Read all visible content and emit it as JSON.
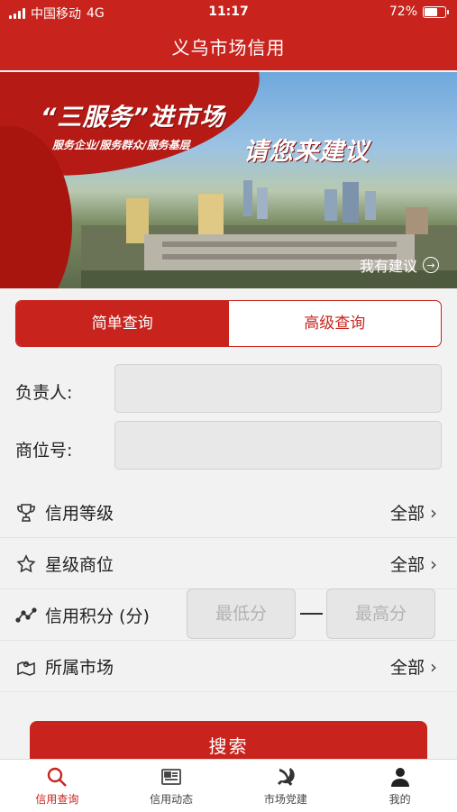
{
  "status_bar": {
    "carrier": "中国移动",
    "network": "4G",
    "time": "11:17",
    "battery": "72%",
    "battery_level": 0.72
  },
  "nav": {
    "title": "义乌市场信用"
  },
  "banner": {
    "headline": "“三服务”进市场",
    "subline": "服务企业/服务群众/服务基层",
    "slogan": "请您来建议",
    "suggest_link": "我有建议"
  },
  "tabs": {
    "simple": "简单查询",
    "advanced": "高级查询"
  },
  "form": {
    "owner_label": "负责人:",
    "booth_label": "商位号:",
    "credit_level": {
      "label": "信用等级",
      "value": "全部"
    },
    "star_booth": {
      "label": "星级商位",
      "value": "全部"
    },
    "credit_score": {
      "label": "信用积分 (分)",
      "min_placeholder": "最低分",
      "max_placeholder": "最高分"
    },
    "market": {
      "label": "所属市场",
      "value": "全部"
    }
  },
  "search_button": "搜索",
  "tabbar": [
    {
      "label": "信用查询",
      "icon": "search-icon"
    },
    {
      "label": "信用动态",
      "icon": "newspaper-icon"
    },
    {
      "label": "市场党建",
      "icon": "party-emblem-icon"
    },
    {
      "label": "我的",
      "icon": "person-icon"
    }
  ],
  "colors": {
    "accent": "#c8241d",
    "background": "#f2f2f2"
  }
}
